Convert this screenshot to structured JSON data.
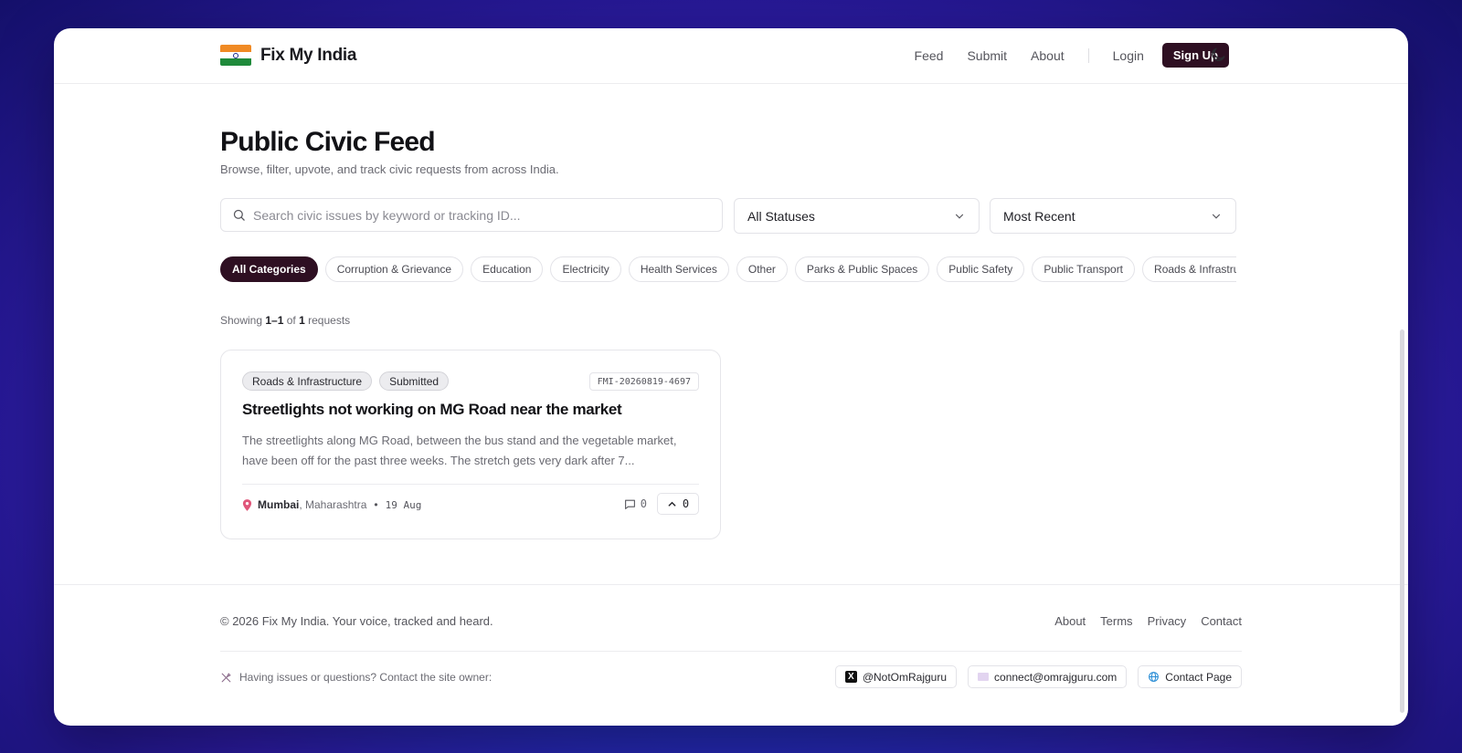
{
  "brand": {
    "name": "Fix My India"
  },
  "nav": {
    "feed": "Feed",
    "submit": "Submit",
    "about": "About",
    "login": "Login",
    "signup": "Sign Up"
  },
  "hero": {
    "title": "Public Civic Feed",
    "subtitle": "Browse, filter, upvote, and track civic requests from across India."
  },
  "search": {
    "placeholder": "Search civic issues by keyword or tracking ID...",
    "value": ""
  },
  "filters": {
    "status": "All Statuses",
    "sort": "Most Recent"
  },
  "categories": [
    "All Categories",
    "Corruption & Grievance",
    "Education",
    "Electricity",
    "Health Services",
    "Other",
    "Parks & Public Spaces",
    "Public Safety",
    "Public Transport",
    "Roads & Infrastructure"
  ],
  "showing": {
    "prefix": "Showing",
    "range": "1–1",
    "of": "of",
    "total": "1",
    "suffix": "requests"
  },
  "requests": [
    {
      "category": "Roads & Infrastructure",
      "status": "Submitted",
      "tracking_id": "FMI-20260819-4697",
      "title": "Streetlights not working on MG Road near the market",
      "description": "The streetlights along MG Road, between the bus stand and the vegetable market, have been off for the past three weeks. The stretch gets very dark after 7...",
      "city": "Mumbai",
      "state": ", Maharashtra",
      "date": "19 Aug",
      "comments": "0",
      "upvotes": "0"
    }
  ],
  "footer": {
    "copyright": "© 2026 Fix My India. Your voice, tracked and heard.",
    "links": {
      "about": "About",
      "terms": "Terms",
      "privacy": "Privacy",
      "contact": "Contact"
    },
    "contact_note": "Having issues or questions? Contact the site owner:",
    "twitter": "@NotOmRajguru",
    "email": "connect@omrajguru.com",
    "contact_page": "Contact Page"
  },
  "colors": {
    "primary": "#2e0f22",
    "background_gradient": "#1f2fb8"
  },
  "icons": [
    "india-flag-icon",
    "moon-icon",
    "search-icon",
    "chevron-down-icon",
    "map-pin-icon",
    "comment-icon",
    "chevron-up-icon",
    "tools-icon",
    "x-icon",
    "mail-icon",
    "globe-icon"
  ]
}
